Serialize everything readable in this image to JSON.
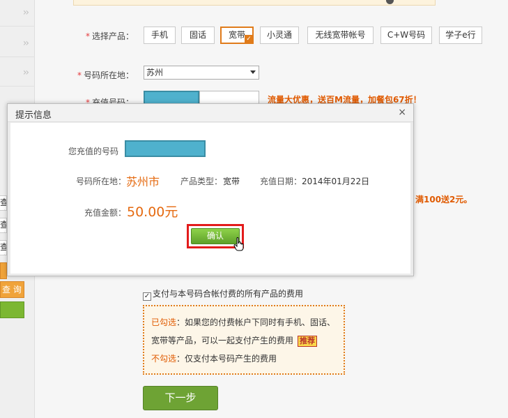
{
  "sidebar": {
    "buttons": [
      "查询",
      "查询",
      "查询"
    ],
    "orange_button": "查 询"
  },
  "form": {
    "product_label": "选择产品：",
    "products": [
      "手机",
      "固话",
      "宽带",
      "小灵通",
      "无线宽带帐号",
      "C+W号码",
      "学子e行"
    ],
    "selected_product": "宽带",
    "location_label": "号码所在地：",
    "location_value": "苏州",
    "recharge_label": "充值号码：",
    "promo_text": "流量大优惠，送百M流量，加餐包67折！",
    "promo_text_2": "满100送2元。",
    "pay_all_text": "支付与本号码合帐付费的所有产品的费用",
    "option_checked_tag": "已勾选",
    "option_checked_text": "：如果您的付费帐户下同时有手机、固话、宽带等产品，可以一起支付产生的费用",
    "recommend_badge": "推荐",
    "option_unchecked_tag": "不勾选",
    "option_unchecked_text": "：仅支付本号码产生的费用",
    "next_button": "下一步"
  },
  "dialog": {
    "title": "提示信息",
    "close_symbol": "×",
    "number_label": "您充值的号码",
    "location_label": "号码所在地：",
    "location_value": "苏州市",
    "product_type_label": "产品类型：",
    "product_type_value": "宽带",
    "date_label": "充值日期：",
    "date_value": "2014年01月22日",
    "amount_label": "充值金额：",
    "amount_value": "50.00元",
    "confirm_button": "确认"
  }
}
